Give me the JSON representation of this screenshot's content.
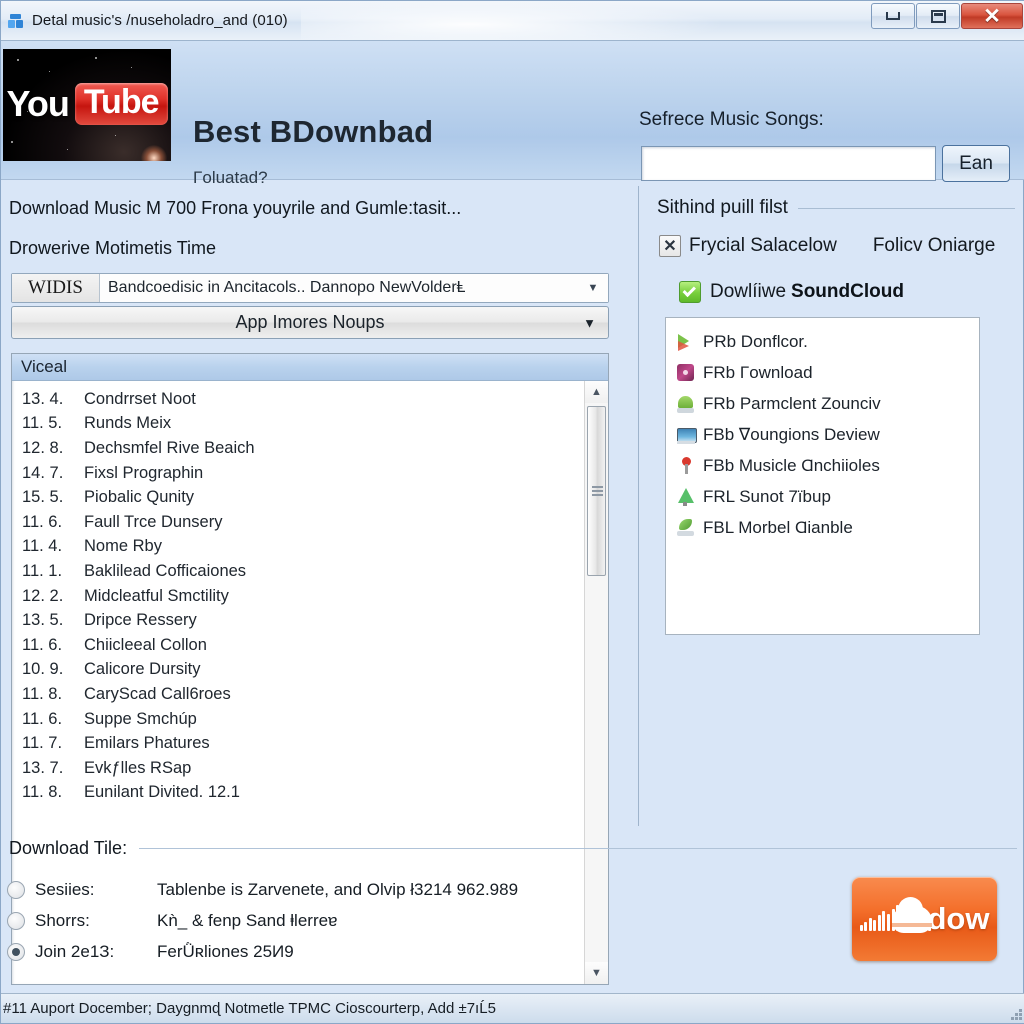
{
  "window": {
    "title": "Detal music's /nuseholadro_and (010)",
    "icon": "app-icon",
    "controls": {
      "minimize": "minimize-icon",
      "maximize": "maximize-icon",
      "close": "✕"
    }
  },
  "banner": {
    "logo_text_you": "You",
    "logo_text_tube": "Tube",
    "title": "Best BDownbad",
    "subtitle": "Γoluatad?",
    "search_label": "Sefrece Music Songs:",
    "search_value": "",
    "search_placeholder": "",
    "search_button": "Ean"
  },
  "left": {
    "heading1": "Download Music M 700 Frona youyrile and Gumle:tasit...",
    "heading2": "Drowerive Motimetis Time",
    "combo1": {
      "tag": "WIDIS",
      "value": "Bandcoedisic in Ancitacols.. Dannopo NewVolderⱠ",
      "arrow": "▼"
    },
    "combo2": {
      "label": "App Imores Noups",
      "arrow": "▼"
    },
    "list_header": "Viceal",
    "list_items": [
      {
        "num": "13. 4.",
        "text": "Condrrset Noot"
      },
      {
        "num": "11. 5.",
        "text": "Runds Meix"
      },
      {
        "num": "12. 8.",
        "text": "Dechsmfel Rive Beaich"
      },
      {
        "num": "14. 7.",
        "text": "Fixsl Prographin"
      },
      {
        "num": "15. 5.",
        "text": "Piobalic Qunity"
      },
      {
        "num": "11. 6.",
        "text": "Faull Trce Dunsery"
      },
      {
        "num": "11. 4.",
        "text": "Nome Rby"
      },
      {
        "num": "11. 1.",
        "text": "Baklilead Cofficaiones"
      },
      {
        "num": "12. 2.",
        "text": "Midcleatful Smctility"
      },
      {
        "num": "13. 5.",
        "text": "Dripce Ressery"
      },
      {
        "num": "11. 6.",
        "text": "Chiicleeal Collon"
      },
      {
        "num": "10. 9.",
        "text": "Calicore Dursity"
      },
      {
        "num": "11. 8.",
        "text": "CaryScad Call6roes"
      },
      {
        "num": "11. 6.",
        "text": "Suppe Smchúp"
      },
      {
        "num": "11. 7.",
        "text": "Emilars Phatures"
      },
      {
        "num": "13. 7.",
        "text": "Evkƒlles RЅap"
      },
      {
        "num": "11. 8.",
        "text": "Eunilant Divited. 12.1"
      }
    ],
    "scroll": {
      "up": "▲",
      "down": "▼"
    }
  },
  "right": {
    "section_title": "Sithind puill filst",
    "checkbox_x": {
      "mark": "✕",
      "label": "Frycial Salacelow",
      "label2": "Folicv Oniarge"
    },
    "checkbox_green": {
      "label": "Dowlíiwe",
      "label_bold": "SoundCloud"
    },
    "file_items": [
      {
        "icon": "play-icon",
        "text": "PRb Donflcor."
      },
      {
        "icon": "disc-icon",
        "text": "FRb Γownload"
      },
      {
        "icon": "android-icon",
        "text": "FRb Parmclent Zounciv"
      },
      {
        "icon": "picture-icon",
        "text": "FBb ∇oungions Deview"
      },
      {
        "icon": "pin-icon",
        "text": "FBb Musicle Ɑnchiioles"
      },
      {
        "icon": "tree-icon",
        "text": "FRL Sunot 7ïbup"
      },
      {
        "icon": "leaf-icon",
        "text": "FBL Morbel Ɑianble"
      }
    ]
  },
  "bottom": {
    "title": "Download Tile:",
    "options": [
      {
        "selected": false,
        "label": "Sesiies:",
        "value": "Tablenbe is Zarvenete, and Olvip ł3214 962.989"
      },
      {
        "selected": false,
        "label": "Shorrs:",
        "value": "Kǹ_ & fenp Sand ⱡlerreɐ"
      },
      {
        "selected": true,
        "label": "Join 2е1З:",
        "value": "FerǛʀlionеs 25И9"
      }
    ],
    "soundcloud_button": "dow"
  },
  "status": {
    "text": "#11 Auport Docember; Dayɡnmɖ Notmetle TPMC Cioscоurterp, Add ±7ıĹ5"
  }
}
